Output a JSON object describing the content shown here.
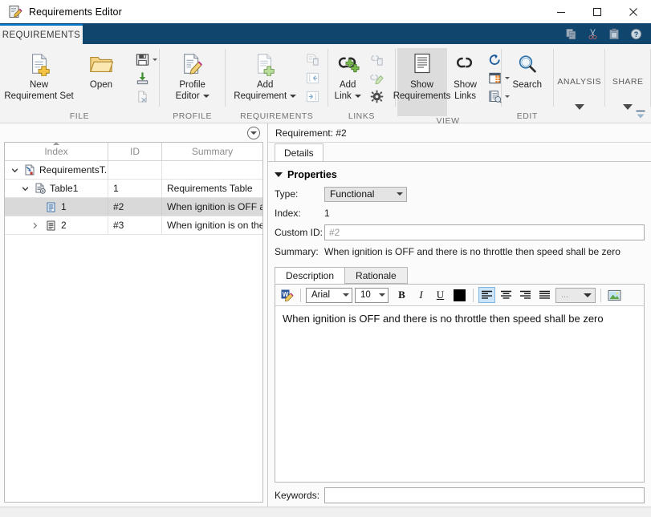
{
  "window": {
    "title": "Requirements Editor",
    "icon": "requirements-editor-icon",
    "minimize_label": "Minimize",
    "maximize_label": "Maximize",
    "close_label": "Close"
  },
  "quick_access": [
    {
      "name": "copy-icon",
      "label": "Copy"
    },
    {
      "name": "cut-icon",
      "label": "Cut"
    },
    {
      "name": "paste-icon",
      "label": "Paste"
    },
    {
      "name": "help-icon",
      "label": "Help"
    }
  ],
  "ribbon": {
    "tabs": [
      {
        "label": "REQUIREMENTS",
        "active": true
      }
    ],
    "groups": [
      {
        "label": "FILE",
        "big": [
          {
            "label_line1": "New",
            "label_line2": "Requirement Set",
            "icon": "new-requirement-set-icon"
          },
          {
            "label_line1": "Open",
            "label_line2": "",
            "icon": "open-folder-icon"
          }
        ],
        "small": [
          {
            "label": "Save",
            "icon": "save-icon",
            "has_caret": true,
            "enabled": true
          },
          {
            "label": "Save As",
            "icon": "save-as-icon",
            "has_caret": false,
            "enabled": true
          },
          {
            "label": "Close",
            "icon": "close-file-icon",
            "has_caret": false,
            "enabled": false
          }
        ]
      },
      {
        "label": "PROFILE",
        "big": [
          {
            "label_line1": "Profile",
            "label_line2": "Editor",
            "icon": "profile-editor-icon",
            "has_caret": true
          }
        ],
        "small": []
      },
      {
        "label": "REQUIREMENTS",
        "big": [
          {
            "label_line1": "Add",
            "label_line2": "Requirement",
            "icon": "add-requirement-icon",
            "has_caret": true
          }
        ],
        "small": [
          {
            "label": "Delete Requirement",
            "icon": "delete-requirement-icon",
            "enabled": false
          },
          {
            "label": "Promote",
            "icon": "promote-icon",
            "enabled": false
          },
          {
            "label": "Demote",
            "icon": "demote-icon",
            "enabled": false
          }
        ]
      },
      {
        "label": "LINKS",
        "big": [
          {
            "label_line1": "Add",
            "label_line2": "Link",
            "icon": "add-link-icon",
            "has_caret": true
          }
        ],
        "small": [
          {
            "label": "Delete Link",
            "icon": "delete-link-icon",
            "enabled": false
          },
          {
            "label": "Edit Link",
            "icon": "edit-link-icon",
            "enabled": false
          },
          {
            "label": "Link Settings",
            "icon": "link-settings-icon",
            "enabled": true
          }
        ]
      },
      {
        "label": "VIEW",
        "big": [
          {
            "label_line1": "Show",
            "label_line2": "Requirements",
            "icon": "show-requirements-icon",
            "selected": true
          },
          {
            "label_line1": "Show",
            "label_line2": "Links",
            "icon": "show-links-icon",
            "selected": false
          }
        ],
        "small": [
          {
            "label": "Refresh",
            "icon": "refresh-icon",
            "enabled": true
          },
          {
            "label": "Columns",
            "icon": "columns-icon",
            "has_caret": true,
            "enabled": true
          },
          {
            "label": "Report",
            "icon": "report-icon",
            "has_caret": true,
            "enabled": true
          }
        ]
      },
      {
        "label": "EDIT",
        "big": [
          {
            "label_line1": "Search",
            "label_line2": "",
            "icon": "search-icon"
          }
        ],
        "small": []
      }
    ],
    "galleries": [
      {
        "label": "ANALYSIS",
        "name": "analysis-gallery"
      },
      {
        "label": "SHARE",
        "name": "share-gallery"
      }
    ],
    "minimize_ribbon": "minimize-ribbon-icon"
  },
  "tree": {
    "filter_icon": "filter-dropdown-icon",
    "columns": [
      {
        "label": "Index",
        "sorted": true
      },
      {
        "label": "ID",
        "sorted": false
      },
      {
        "label": "Summary",
        "sorted": false
      }
    ],
    "rows": [
      {
        "index": "RequirementsT...",
        "id": "",
        "summary": "",
        "depth": 0,
        "twisty": "expanded",
        "icon": "requirement-set-icon",
        "selected": false
      },
      {
        "index": "Table1",
        "id": "1",
        "summary": "Requirements Table",
        "depth": 1,
        "twisty": "expanded",
        "icon": "requirement-group-icon",
        "selected": false
      },
      {
        "index": "1",
        "id": "#2",
        "summary": "When ignition is OFF an...",
        "depth": 2,
        "twisty": "none",
        "icon": "requirement-item-icon",
        "selected": true
      },
      {
        "index": "2",
        "id": "#3",
        "summary": "When ignition is on the...",
        "depth": 2,
        "twisty": "collapsed",
        "icon": "requirement-item-icon",
        "selected": false
      }
    ]
  },
  "details": {
    "header": "Requirement: #2",
    "tabs": [
      {
        "label": "Details",
        "active": true
      }
    ],
    "section_title": "Properties",
    "fields": {
      "type_label": "Type:",
      "type_value": "Functional",
      "index_label": "Index:",
      "index_value": "1",
      "custom_id_label": "Custom ID:",
      "custom_id_value": "",
      "custom_id_placeholder": "#2",
      "summary_label": "Summary:",
      "summary_value": "When ignition is OFF and there is no throttle then speed shall be zero",
      "keywords_label": "Keywords:",
      "keywords_value": ""
    },
    "doc_tabs": [
      {
        "label": "Description",
        "active": true
      },
      {
        "label": "Rationale",
        "active": false
      }
    ],
    "editor": {
      "toolbar": {
        "open_in_word": "open-in-word-icon",
        "font_family": "Arial",
        "font_size": "10",
        "bold": "B",
        "italic": "I",
        "underline": "U",
        "text_color": "#000000",
        "align_left": "align-left-icon",
        "align_center": "align-center-icon",
        "align_right": "align-right-icon",
        "align_justify": "align-justify-icon",
        "list_style": "...",
        "insert_image": "insert-image-icon"
      },
      "content": "When ignition is OFF and there is no throttle then speed shall be zero"
    }
  },
  "colors": {
    "ribbon_blue": "#10456e",
    "tab_accent": "#0076c6",
    "selection_gray": "#d9d9d9",
    "toggle_blue": "#cce4f7"
  }
}
